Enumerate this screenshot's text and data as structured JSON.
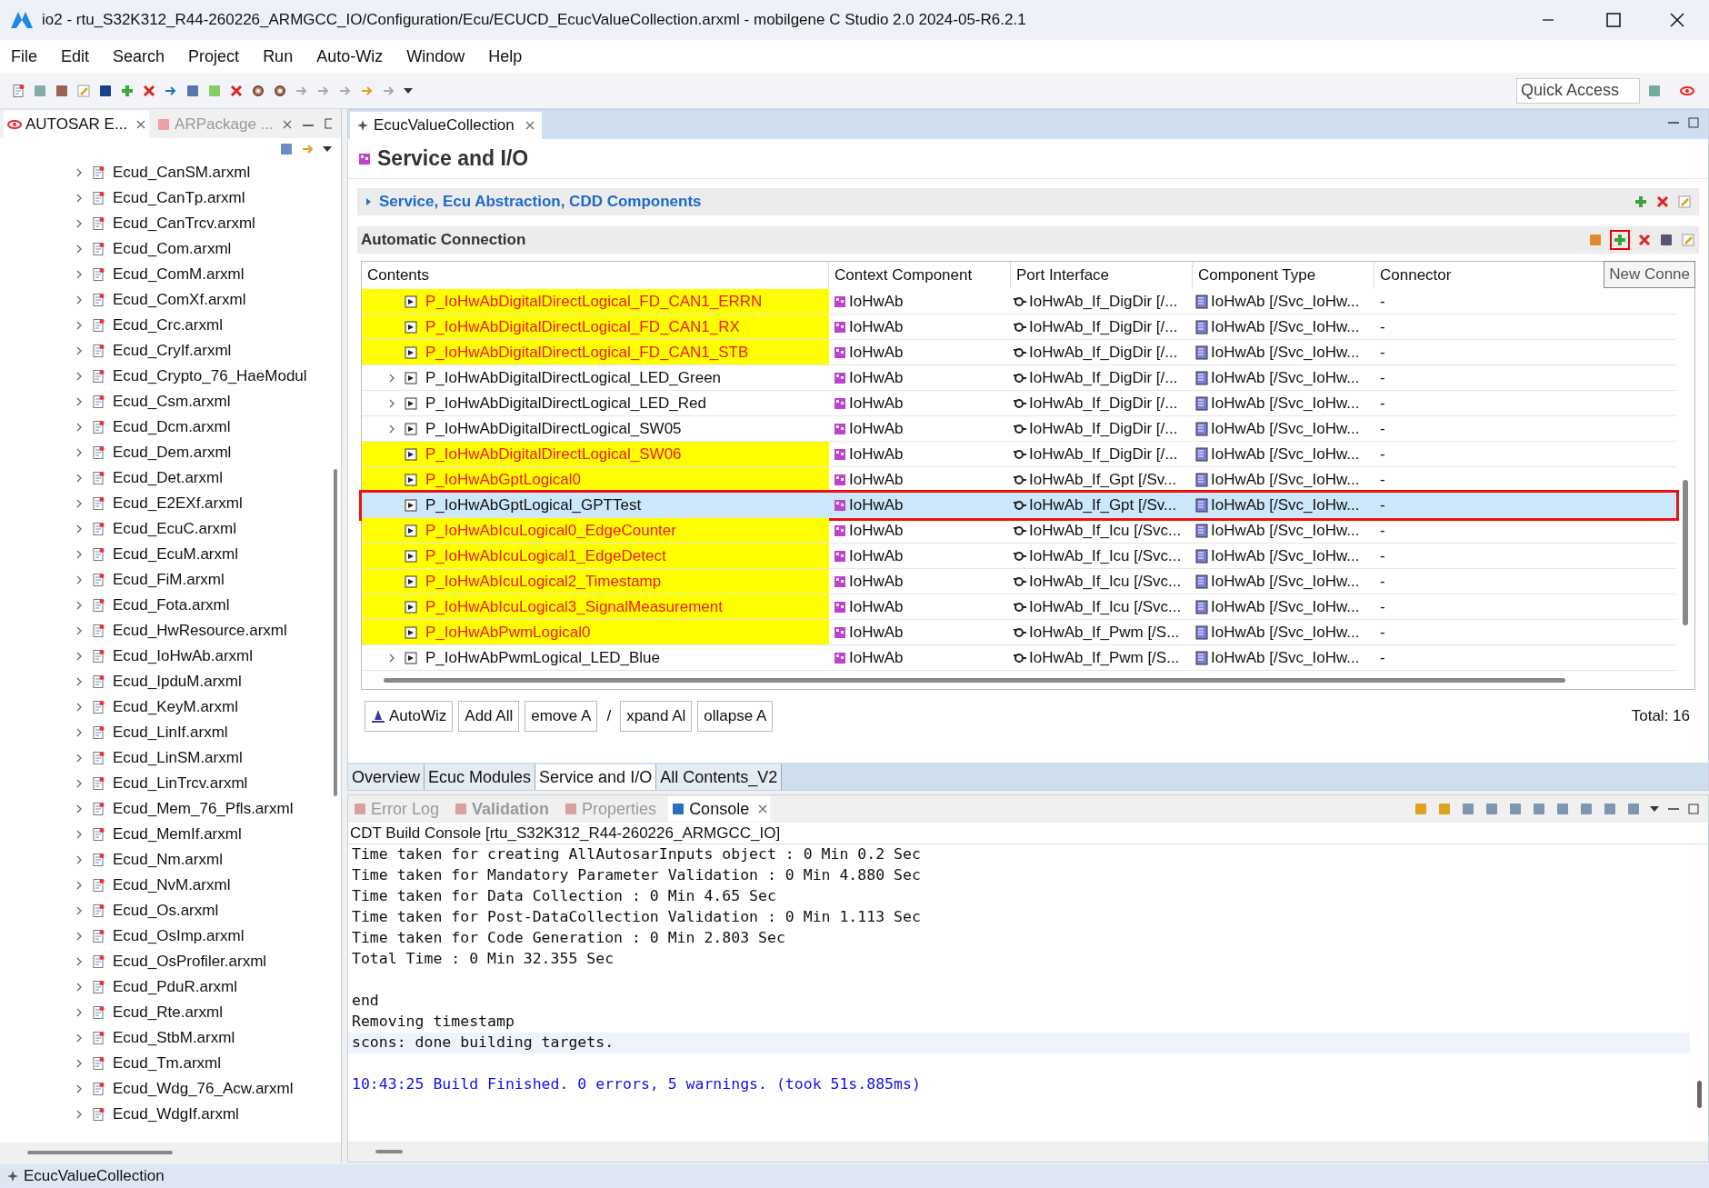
{
  "window": {
    "title": "io2 - rtu_S32K312_R44-260226_ARMGCC_IO/Configuration/Ecu/ECUCD_EcucValueCollection.arxml - mobilgene C Studio 2.0 2024-05-R6.2.1"
  },
  "menu": [
    "File",
    "Edit",
    "Search",
    "Project",
    "Run",
    "Auto-Wiz",
    "Window",
    "Help"
  ],
  "quick_access": {
    "placeholder": "Quick Access"
  },
  "left_panel": {
    "tabs": [
      {
        "label": "AUTOSAR E...",
        "selected": true
      },
      {
        "label": "ARPackage ...",
        "selected": false
      }
    ],
    "items": [
      "Ecud_CanSM.arxml",
      "Ecud_CanTp.arxml",
      "Ecud_CanTrcv.arxml",
      "Ecud_Com.arxml",
      "Ecud_ComM.arxml",
      "Ecud_ComXf.arxml",
      "Ecud_Crc.arxml",
      "Ecud_CryIf.arxml",
      "Ecud_Crypto_76_HaeModul",
      "Ecud_Csm.arxml",
      "Ecud_Dcm.arxml",
      "Ecud_Dem.arxml",
      "Ecud_Det.arxml",
      "Ecud_E2EXf.arxml",
      "Ecud_EcuC.arxml",
      "Ecud_EcuM.arxml",
      "Ecud_FiM.arxml",
      "Ecud_Fota.arxml",
      "Ecud_HwResource.arxml",
      "Ecud_IoHwAb.arxml",
      "Ecud_IpduM.arxml",
      "Ecud_KeyM.arxml",
      "Ecud_LinIf.arxml",
      "Ecud_LinSM.arxml",
      "Ecud_LinTrcv.arxml",
      "Ecud_Mem_76_Pfls.arxml",
      "Ecud_MemIf.arxml",
      "Ecud_Nm.arxml",
      "Ecud_NvM.arxml",
      "Ecud_Os.arxml",
      "Ecud_OsImp.arxml",
      "Ecud_OsProfiler.arxml",
      "Ecud_PduR.arxml",
      "Ecud_Rte.arxml",
      "Ecud_StbM.arxml",
      "Ecud_Tm.arxml",
      "Ecud_Wdg_76_Acw.arxml",
      "Ecud_WdgIf.arxml"
    ]
  },
  "editor": {
    "tab": "EcucValueCollection",
    "title": "Service and I/O",
    "section": {
      "label": "Service, Ecu Abstraction, CDD Components",
      "expanded": false
    },
    "connection": {
      "title": "Automatic Connection",
      "tooltip": "New Conne",
      "columns": [
        "Contents",
        "Context Component",
        "Port Interface",
        "Component Type",
        "Connector"
      ],
      "rows": [
        {
          "contents": "P_IoHwAbDigitalDirectLogical_FD_CAN1_ERRN",
          "context": "IoHwAb",
          "port": "IoHwAb_If_DigDir [/...",
          "type": "IoHwAb [/Svc_IoHw...",
          "connector": "-",
          "expandable": false,
          "unconnected": true,
          "selected": false
        },
        {
          "contents": "P_IoHwAbDigitalDirectLogical_FD_CAN1_RX",
          "context": "IoHwAb",
          "port": "IoHwAb_If_DigDir [/...",
          "type": "IoHwAb [/Svc_IoHw...",
          "connector": "-",
          "expandable": false,
          "unconnected": true,
          "selected": false
        },
        {
          "contents": "P_IoHwAbDigitalDirectLogical_FD_CAN1_STB",
          "context": "IoHwAb",
          "port": "IoHwAb_If_DigDir [/...",
          "type": "IoHwAb [/Svc_IoHw...",
          "connector": "-",
          "expandable": false,
          "unconnected": true,
          "selected": false
        },
        {
          "contents": "P_IoHwAbDigitalDirectLogical_LED_Green",
          "context": "IoHwAb",
          "port": "IoHwAb_If_DigDir [/...",
          "type": "IoHwAb [/Svc_IoHw...",
          "connector": "-",
          "expandable": true,
          "unconnected": false,
          "selected": false
        },
        {
          "contents": "P_IoHwAbDigitalDirectLogical_LED_Red",
          "context": "IoHwAb",
          "port": "IoHwAb_If_DigDir [/...",
          "type": "IoHwAb [/Svc_IoHw...",
          "connector": "-",
          "expandable": true,
          "unconnected": false,
          "selected": false
        },
        {
          "contents": "P_IoHwAbDigitalDirectLogical_SW05",
          "context": "IoHwAb",
          "port": "IoHwAb_If_DigDir [/...",
          "type": "IoHwAb [/Svc_IoHw...",
          "connector": "-",
          "expandable": true,
          "unconnected": false,
          "selected": false
        },
        {
          "contents": "P_IoHwAbDigitalDirectLogical_SW06",
          "context": "IoHwAb",
          "port": "IoHwAb_If_DigDir [/...",
          "type": "IoHwAb [/Svc_IoHw...",
          "connector": "-",
          "expandable": false,
          "unconnected": true,
          "selected": false
        },
        {
          "contents": "P_IoHwAbGptLogical0",
          "context": "IoHwAb",
          "port": "IoHwAb_If_Gpt [/Sv...",
          "type": "IoHwAb [/Svc_IoHw...",
          "connector": "-",
          "expandable": false,
          "unconnected": true,
          "selected": false
        },
        {
          "contents": "P_IoHwAbGptLogical_GPTTest",
          "context": "IoHwAb",
          "port": "IoHwAb_If_Gpt [/Sv...",
          "type": "IoHwAb [/Svc_IoHw...",
          "connector": "-",
          "expandable": false,
          "unconnected": false,
          "selected": true
        },
        {
          "contents": "P_IoHwAbIcuLogical0_EdgeCounter",
          "context": "IoHwAb",
          "port": "IoHwAb_If_Icu [/Svc...",
          "type": "IoHwAb [/Svc_IoHw...",
          "connector": "-",
          "expandable": false,
          "unconnected": true,
          "selected": false
        },
        {
          "contents": "P_IoHwAbIcuLogical1_EdgeDetect",
          "context": "IoHwAb",
          "port": "IoHwAb_If_Icu [/Svc...",
          "type": "IoHwAb [/Svc_IoHw...",
          "connector": "-",
          "expandable": false,
          "unconnected": true,
          "selected": false
        },
        {
          "contents": "P_IoHwAbIcuLogical2_Timestamp",
          "context": "IoHwAb",
          "port": "IoHwAb_If_Icu [/Svc...",
          "type": "IoHwAb [/Svc_IoHw...",
          "connector": "-",
          "expandable": false,
          "unconnected": true,
          "selected": false
        },
        {
          "contents": "P_IoHwAbIcuLogical3_SignalMeasurement",
          "context": "IoHwAb",
          "port": "IoHwAb_If_Icu [/Svc...",
          "type": "IoHwAb [/Svc_IoHw...",
          "connector": "-",
          "expandable": false,
          "unconnected": true,
          "selected": false
        },
        {
          "contents": "P_IoHwAbPwmLogical0",
          "context": "IoHwAb",
          "port": "IoHwAb_If_Pwm [/S...",
          "type": "IoHwAb [/Svc_IoHw...",
          "connector": "-",
          "expandable": false,
          "unconnected": true,
          "selected": false
        },
        {
          "contents": "P_IoHwAbPwmLogical_LED_Blue",
          "context": "IoHwAb",
          "port": "IoHwAb_If_Pwm [/S...",
          "type": "IoHwAb [/Svc_IoHw...",
          "connector": "-",
          "expandable": true,
          "unconnected": false,
          "selected": false
        }
      ],
      "buttons": [
        {
          "kind": "button",
          "label": "AutoWiz",
          "icon": true
        },
        {
          "kind": "button",
          "label": "Add All",
          "icon": false
        },
        {
          "kind": "button",
          "label": "emove A",
          "icon": false
        },
        {
          "kind": "separator",
          "label": "/"
        },
        {
          "kind": "button",
          "label": "xpand Al",
          "icon": false
        },
        {
          "kind": "button",
          "label": "ollapse A",
          "icon": false
        }
      ],
      "total": "Total: 16"
    },
    "pages": [
      {
        "label": "Overview",
        "selected": false
      },
      {
        "label": "Ecuc Modules",
        "selected": false
      },
      {
        "label": "Service and I/O",
        "selected": true
      },
      {
        "label": "All Contents_V2",
        "selected": false
      }
    ]
  },
  "views": {
    "tabs": [
      {
        "label": "Error Log",
        "selected": false,
        "bold": false
      },
      {
        "label": "Validation",
        "selected": false,
        "bold": true
      },
      {
        "label": "Properties",
        "selected": false,
        "bold": false
      },
      {
        "label": "Console",
        "selected": true,
        "bold": false
      }
    ],
    "console_title": "CDT Build Console [rtu_S32K312_R44-260226_ARMGCC_IO]",
    "lines": [
      {
        "kind": "normal",
        "text": "Time taken for creating AllAutosarInputs object : 0 Min 0.2 Sec"
      },
      {
        "kind": "normal",
        "text": "Time taken for Mandatory Parameter Validation : 0 Min 4.880 Sec"
      },
      {
        "kind": "normal",
        "text": "Time taken for Data Collection : 0 Min 4.65 Sec"
      },
      {
        "kind": "normal",
        "text": "Time taken for Post-DataCollection Validation : 0 Min 1.113 Sec"
      },
      {
        "kind": "normal",
        "text": "Time taken for Code Generation : 0 Min 2.803 Sec"
      },
      {
        "kind": "normal",
        "text": "Total Time : 0 Min 32.355 Sec"
      },
      {
        "kind": "blank"
      },
      {
        "kind": "normal",
        "text": "end"
      },
      {
        "kind": "normal",
        "text": "Removing timestamp"
      },
      {
        "kind": "current",
        "text": "scons: done building targets."
      },
      {
        "kind": "blank"
      },
      {
        "kind": "info",
        "text": "10:43:25 Build Finished. 0 errors, 5 warnings. (took 51s.885ms)"
      }
    ]
  },
  "status_bar": {
    "text": "EcucValueCollection"
  }
}
